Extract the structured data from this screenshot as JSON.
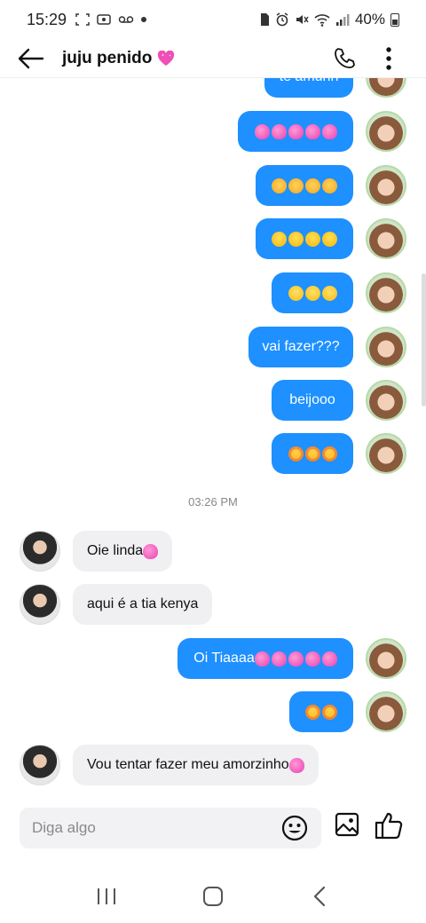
{
  "status_bar": {
    "time": "15:29",
    "battery": "40%"
  },
  "header": {
    "contact_name": "juju penido",
    "name_emoji": "pink-heart-icon"
  },
  "messages": [
    {
      "side": "out",
      "text": "te amuhh",
      "partial": true
    },
    {
      "side": "out",
      "emoji": [
        "sparkling-heart",
        "sparkling-heart",
        "sparkling-heart",
        "sparkling-heart",
        "sparkling-heart"
      ]
    },
    {
      "side": "out",
      "emoji": [
        "weary-cat",
        "weary-cat",
        "weary-cat",
        "weary-cat"
      ]
    },
    {
      "side": "out",
      "emoji": [
        "tongue-face",
        "tongue-face",
        "tongue-face",
        "tongue-face"
      ]
    },
    {
      "side": "out",
      "emoji": [
        "kissing-face",
        "kissing-face",
        "kissing-face"
      ]
    },
    {
      "side": "out",
      "text": "vai fazer???"
    },
    {
      "side": "out",
      "text": "beijooo"
    },
    {
      "side": "out",
      "emoji": [
        "heart-eyes-cat",
        "heart-eyes-cat",
        "heart-eyes-cat"
      ]
    },
    {
      "side": "separator",
      "text": "03:26 PM"
    },
    {
      "side": "in",
      "text": "Oie linda"
    },
    {
      "side": "in",
      "text": "aqui é a tia kenya"
    },
    {
      "side": "out",
      "text": "Oi Tiaaaa"
    },
    {
      "side": "out",
      "emoji": [
        "heart-eyes",
        "heart-eyes"
      ]
    },
    {
      "side": "in",
      "text": "Vou tentar fazer meu amorzinho"
    }
  ],
  "composer": {
    "placeholder": "Diga algo"
  },
  "colors": {
    "outgoing_bubble": "#1e90ff",
    "incoming_bubble": "#f0eff2",
    "accent_heart": "#e93fb3"
  },
  "icons": {
    "back": "arrow-left-icon",
    "call": "phone-icon",
    "more": "more-vertical-icon",
    "emoji": "smiley-icon",
    "gallery": "image-icon",
    "like": "thumbs-up-icon",
    "recents": "recents-icon",
    "home": "home-icon",
    "nav_back": "nav-back-icon"
  }
}
